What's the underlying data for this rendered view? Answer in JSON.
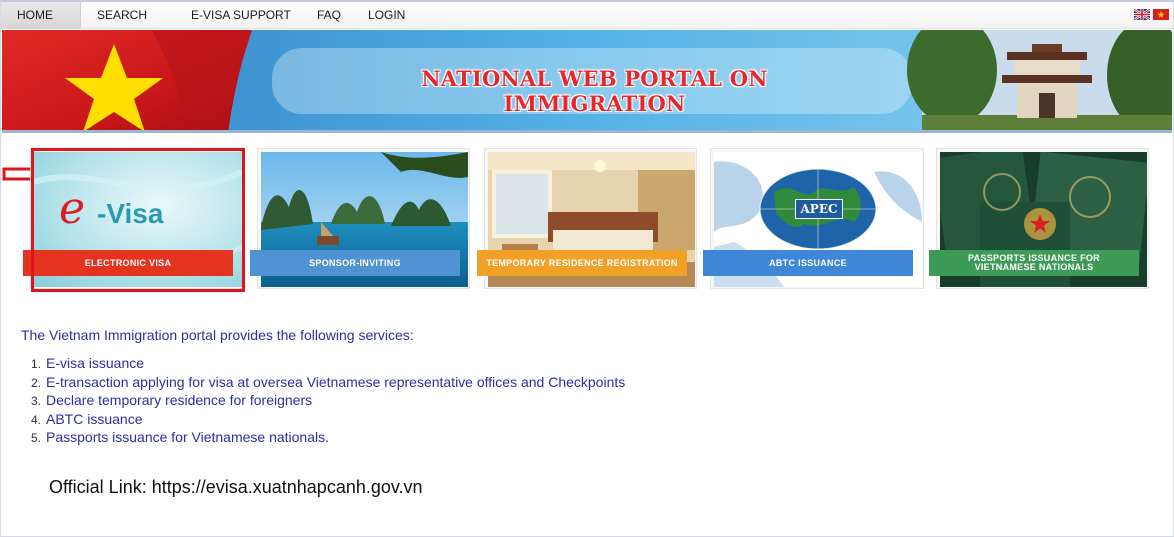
{
  "nav": {
    "items": [
      "HOME",
      "SEARCH",
      "E-VISA SUPPORT",
      "FAQ",
      "LOGIN"
    ],
    "active_index": 0
  },
  "banner": {
    "title": "NATIONAL WEB PORTAL ON IMMIGRATION"
  },
  "tiles": [
    {
      "label": "ELECTRONIC VISA",
      "logo_text": "e-Visa",
      "label_color": "#e4341f",
      "icon": "e-visa-logo"
    },
    {
      "label": "SPONSOR-INVITING",
      "label_color": "#4f93d3",
      "icon": "halong-bay-photo"
    },
    {
      "label": "TEMPORARY RESIDENCE REGISTRATION",
      "label_color": "#f1a128",
      "icon": "hotel-room-photo"
    },
    {
      "label": "ABTC ISSUANCE",
      "logo_text": "APEC",
      "label_color": "#3f86d6",
      "icon": "apec-globe-logo"
    },
    {
      "label": "PASSPORTS ISSUANCE FOR VIETNAMESE NATIONALS",
      "label_color": "#3d9b57",
      "icon": "passports-photo"
    }
  ],
  "intro": "The Vietnam Immigration portal provides the following services:",
  "services": [
    {
      "num": "1.",
      "text": "E-visa issuance"
    },
    {
      "num": "2.",
      "text": "E-transaction applying for visa at oversea Vietnamese representative offices and Checkpoints"
    },
    {
      "num": "3.",
      "text": "Declare temporary residence for foreigners"
    },
    {
      "num": "4.",
      "text": "ABTC issuance"
    },
    {
      "num": "5.",
      "text": "Passports issuance for Vietnamese nationals."
    }
  ],
  "official_link": "Official Link: https://evisa.xuatnhapcanh.gov.vn",
  "colors": {
    "link_blue": "#2b2fa1",
    "highlight_red": "#e0151b",
    "banner_title_red": "#e8272a"
  }
}
